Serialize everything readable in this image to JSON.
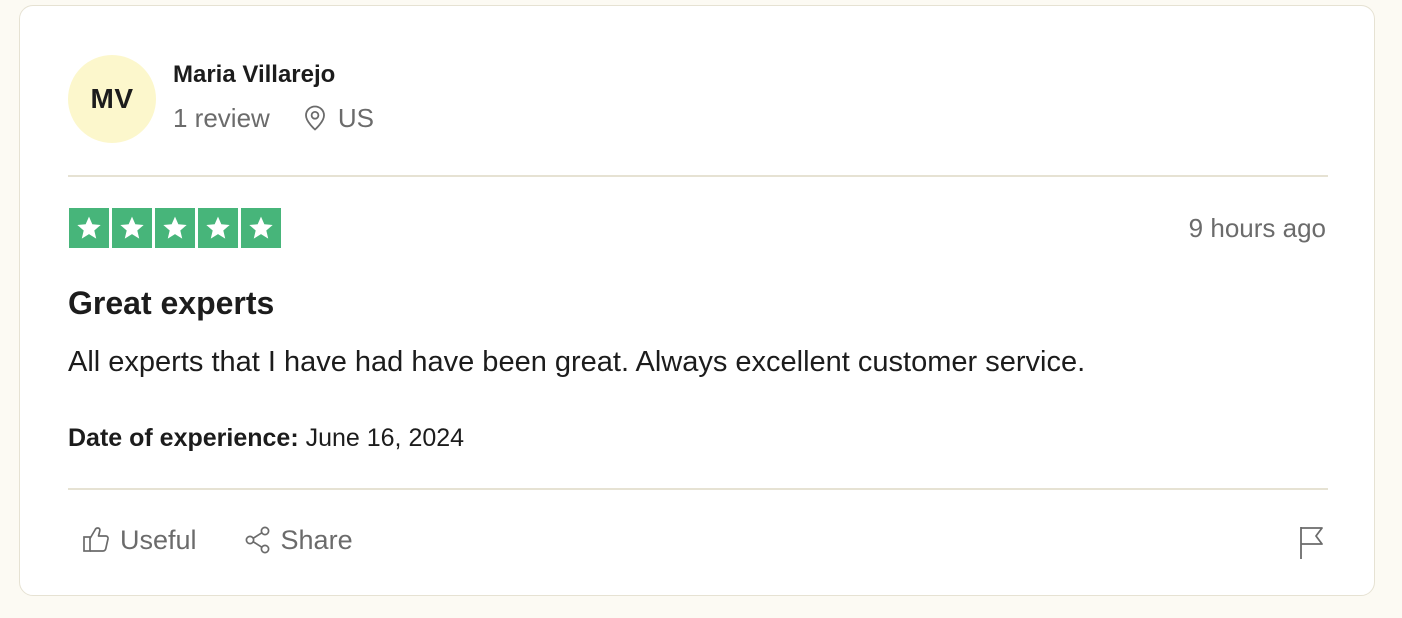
{
  "consumer": {
    "initials": "MV",
    "name": "Maria Villarejo",
    "review_count": "1 review",
    "location": "US",
    "location_icon": "location-pin-icon"
  },
  "review": {
    "rating": 5,
    "rating_max": 5,
    "star_color": "#47b57a",
    "time_ago": "9 hours ago",
    "title": "Great experts",
    "body": "All experts that I have had have been great. Always excellent customer service.",
    "experience_label": "Date of experience:",
    "experience_date": "June 16, 2024"
  },
  "actions": {
    "useful_label": "Useful",
    "useful_icon": "thumbs-up-icon",
    "share_label": "Share",
    "share_icon": "share-icon",
    "report_icon": "flag-icon"
  },
  "colors": {
    "page_background": "#fcfaf3",
    "avatar_background": "#fcf7cc",
    "muted_text": "#6b6b6b",
    "divider": "#e6e2d3"
  }
}
